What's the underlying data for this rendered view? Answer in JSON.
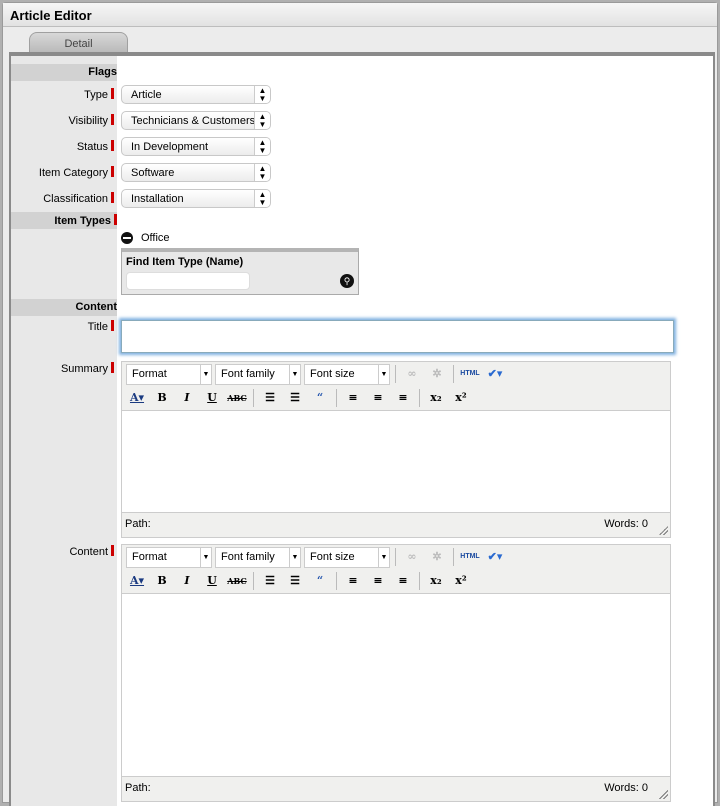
{
  "window": {
    "title": "Article Editor"
  },
  "tabs": [
    {
      "label": "Detail"
    }
  ],
  "sections": {
    "flags": "Flags",
    "item_types": "Item Types",
    "content": "Content"
  },
  "fields": {
    "type": {
      "label": "Type",
      "value": "Article"
    },
    "visibility": {
      "label": "Visibility",
      "value": "Technicians & Customers"
    },
    "status": {
      "label": "Status",
      "value": "In Development"
    },
    "item_category": {
      "label": "Item Category",
      "value": "Software"
    },
    "classification": {
      "label": "Classification",
      "value": "Installation"
    },
    "title": {
      "label": "Title",
      "value": ""
    },
    "summary": {
      "label": "Summary"
    },
    "content": {
      "label": "Content"
    }
  },
  "item_types": {
    "selected": [
      "Office"
    ],
    "find_label": "Find Item Type (Name)",
    "find_value": ""
  },
  "editor": {
    "format": "Format",
    "font_family": "Font family",
    "font_size": "Font size",
    "html": "HTML",
    "path": "Path:",
    "words": "Words: 0"
  },
  "colors": {
    "required": "#cc0000",
    "focus": "#7fb0e0"
  }
}
